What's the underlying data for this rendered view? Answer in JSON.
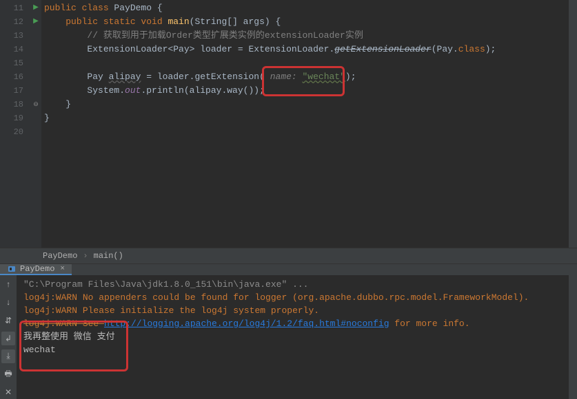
{
  "gutter_lines": [
    "11",
    "12",
    "13",
    "14",
    "15",
    "16",
    "17",
    "18",
    "19",
    "20"
  ],
  "code": {
    "l11": {
      "pre": "",
      "kw": "public class ",
      "cls": "PayDemo ",
      "brace": "{"
    },
    "l12": {
      "pre": "    ",
      "kw": "public static void ",
      "mth": "main",
      "args": "(String[] args) {"
    },
    "l13": {
      "pre": "        ",
      "cmt": "// 获取到用于加载Order类型扩展类实例的extensionLoader实例"
    },
    "l14": {
      "pre": "        ",
      "t1": "ExtensionLoader<Pay> loader = ExtensionLoader.",
      "struck": "getExtensionLoader",
      "t2": "(Pay.",
      "kw": "class",
      "t3": ");"
    },
    "l15": "",
    "l16": {
      "pre": "        ",
      "t1": "Pay ",
      "var": "alipay",
      "t2": " = loader.getExtension( ",
      "param": "name: ",
      "str": "\"wechat\"",
      "t3": ");"
    },
    "l17": {
      "pre": "        ",
      "t1": "System.",
      "st": "out",
      "t2": ".println(alipay.way());"
    },
    "l18": {
      "pre": "    ",
      "brace": "}"
    },
    "l19": {
      "pre": "",
      "brace": "}"
    },
    "l20": ""
  },
  "breadcrumb": {
    "cls": "PayDemo",
    "mth": "main()"
  },
  "console": {
    "tab": "PayDemo",
    "lines": {
      "l1": {
        "path": "\"C:\\Program Files\\Java\\jdk1.8.0_151\\bin\\java.exe\" ..."
      },
      "l2": "log4j:WARN No appenders could be found for logger (org.apache.dubbo.rpc.model.FrameworkModel).",
      "l3": "log4j:WARN Please initialize the log4j system properly.",
      "l4": {
        "pre": "log4j:WARN See ",
        "url": "http://logging.apache.org/log4j/1.2/faq.html#noconfig",
        "post": " for more info."
      },
      "l5": "我再整使用 微信 支付",
      "l6": "wechat"
    }
  }
}
